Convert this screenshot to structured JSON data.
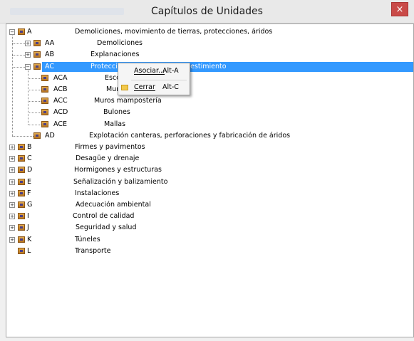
{
  "window": {
    "title": "Capítulos de Unidades",
    "close_glyph": "×"
  },
  "tree": {
    "rows": [
      {
        "code": "A",
        "desc": "Demoliciones, movimiento de tierras, protecciones, áridos",
        "expander": "−"
      },
      {
        "code": "AA",
        "desc": "Demoliciones",
        "expander": "+"
      },
      {
        "code": "AB",
        "desc": "Explanaciones",
        "expander": "+"
      },
      {
        "code": "AC",
        "desc": "Protecciones en taludes y revestimiento",
        "expander": "−",
        "selected": true
      },
      {
        "code": "ACA",
        "desc": "Escolleras"
      },
      {
        "code": "ACB",
        "desc": "Muros"
      },
      {
        "code": "ACC",
        "desc": "Muros mampostería"
      },
      {
        "code": "ACD",
        "desc": "Bulones"
      },
      {
        "code": "ACE",
        "desc": "Mallas"
      },
      {
        "code": "AD",
        "desc": "Explotación canteras, perforaciones y fabricación de áridos"
      },
      {
        "code": "B",
        "desc": "Firmes y pavimentos",
        "expander": "+"
      },
      {
        "code": "C",
        "desc": "Desagüe y drenaje",
        "expander": "+"
      },
      {
        "code": "D",
        "desc": "Hormigones y estructuras",
        "expander": "+"
      },
      {
        "code": "E",
        "desc": "Señalización y balizamiento",
        "expander": "+"
      },
      {
        "code": "F",
        "desc": "Instalaciones",
        "expander": "+"
      },
      {
        "code": "G",
        "desc": "Adecuación ambiental",
        "expander": "+"
      },
      {
        "code": "I",
        "desc": "Control de calidad",
        "expander": "+"
      },
      {
        "code": "J",
        "desc": "Seguridad y salud",
        "expander": "+"
      },
      {
        "code": "K",
        "desc": "Túneles",
        "expander": "+"
      },
      {
        "code": "L",
        "desc": "Transporte"
      }
    ]
  },
  "context_menu": {
    "items": [
      {
        "label": "Asociar...",
        "shortcut": "Alt-A"
      },
      {
        "label": "Cerrar",
        "shortcut": "Alt-C",
        "icon": "folder-icon"
      }
    ]
  }
}
